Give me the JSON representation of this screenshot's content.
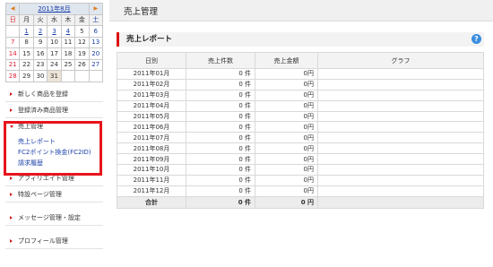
{
  "calendar": {
    "month_label": "2011年8月",
    "prev": "◀",
    "next": "▶",
    "weekdays": [
      "日",
      "月",
      "火",
      "水",
      "木",
      "金",
      "土"
    ],
    "weeks": [
      [
        "",
        "1",
        "2",
        "3",
        "4",
        "5",
        "6"
      ],
      [
        "7",
        "8",
        "9",
        "10",
        "11",
        "12",
        "13"
      ],
      [
        "14",
        "15",
        "16",
        "17",
        "18",
        "19",
        "20"
      ],
      [
        "21",
        "22",
        "23",
        "24",
        "25",
        "26",
        "27"
      ],
      [
        "28",
        "29",
        "30",
        "31",
        "",
        "",
        ""
      ]
    ]
  },
  "menu": {
    "items": [
      "新しく商品を登録",
      "登録済み商品管理",
      "売上管理",
      "アフィリエイト管理",
      "特設ページ管理",
      "メッセージ管理・設定",
      "プロフィール管理"
    ],
    "sub_items": [
      "売上レポート",
      "FC2ポイント換金(FC2ID)",
      "請求履歴"
    ]
  },
  "page": {
    "title": "売上管理",
    "section": "売上レポート",
    "help": "?"
  },
  "table": {
    "headers": [
      "日別",
      "売上件数",
      "売上金額",
      "グラフ"
    ],
    "rows": [
      [
        "2011年01月",
        "0 件",
        "0円"
      ],
      [
        "2011年02月",
        "0 件",
        "0円"
      ],
      [
        "2011年03月",
        "0 件",
        "0円"
      ],
      [
        "2011年04月",
        "0 件",
        "0円"
      ],
      [
        "2011年05月",
        "0 件",
        "0円"
      ],
      [
        "2011年06月",
        "0 件",
        "0円"
      ],
      [
        "2011年07月",
        "0 件",
        "0円"
      ],
      [
        "2011年08月",
        "0 件",
        "0円"
      ],
      [
        "2011年09月",
        "0 件",
        "0円"
      ],
      [
        "2011年10月",
        "0 件",
        "0円"
      ],
      [
        "2011年11月",
        "0 件",
        "0円"
      ],
      [
        "2011年12月",
        "0 件",
        "0円"
      ]
    ],
    "total": [
      "合計",
      "0 件",
      "0 円"
    ]
  }
}
